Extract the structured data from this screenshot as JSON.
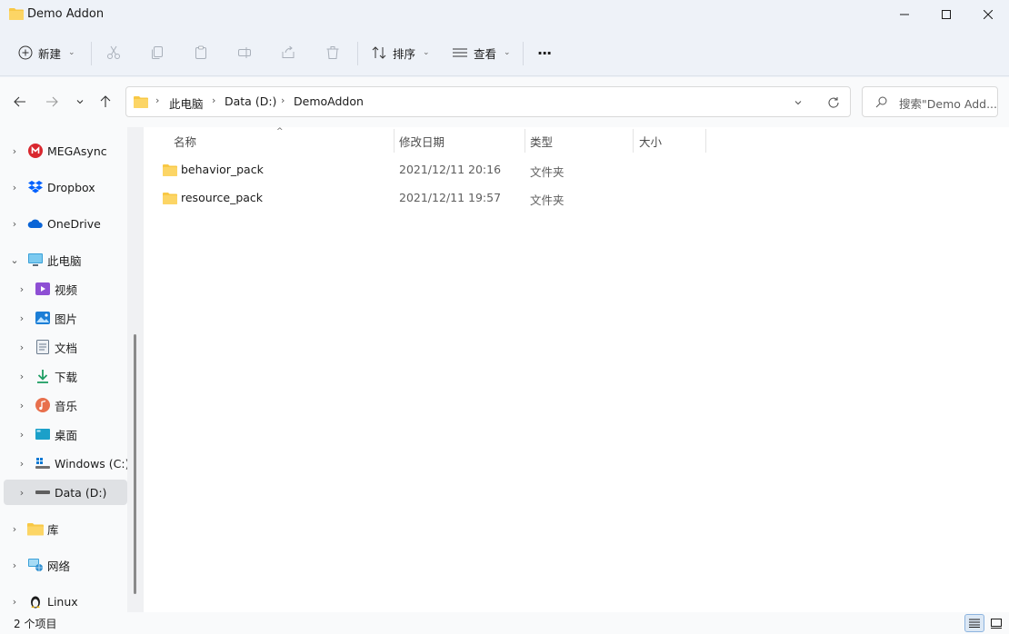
{
  "window": {
    "title": "Demo Addon"
  },
  "toolbar": {
    "new_label": "新建",
    "sort_label": "排序",
    "view_label": "查看",
    "more_label": "···"
  },
  "address": {
    "crumbs": [
      "此电脑",
      "Data (D:)",
      "DemoAddon"
    ],
    "search_placeholder": "搜索\"Demo Add..."
  },
  "sidebar": {
    "items": [
      {
        "label": "MEGAsync",
        "icon": "mega-icon"
      },
      {
        "label": "Dropbox",
        "icon": "dropbox-icon"
      },
      {
        "label": "OneDrive",
        "icon": "onedrive-icon"
      },
      {
        "label": "此电脑",
        "icon": "pc-icon"
      },
      {
        "label": "视频",
        "icon": "video-icon"
      },
      {
        "label": "图片",
        "icon": "pictures-icon"
      },
      {
        "label": "文档",
        "icon": "documents-icon"
      },
      {
        "label": "下载",
        "icon": "download-icon"
      },
      {
        "label": "音乐",
        "icon": "music-icon"
      },
      {
        "label": "桌面",
        "icon": "desktop-icon"
      },
      {
        "label": "Windows (C:)",
        "icon": "drive-c-icon"
      },
      {
        "label": "Data (D:)",
        "icon": "drive-d-icon"
      },
      {
        "label": "库",
        "icon": "library-icon"
      },
      {
        "label": "网络",
        "icon": "network-icon"
      },
      {
        "label": "Linux",
        "icon": "linux-icon"
      }
    ]
  },
  "columns": {
    "name": "名称",
    "date": "修改日期",
    "type": "类型",
    "size": "大小"
  },
  "files": [
    {
      "name": "behavior_pack",
      "date": "2021/12/11 20:16",
      "type": "文件夹"
    },
    {
      "name": "resource_pack",
      "date": "2021/12/11 19:57",
      "type": "文件夹"
    }
  ],
  "status": {
    "count": "2 个项目"
  },
  "colors": {
    "folder": "#f8c845",
    "accent": "#0067c0"
  }
}
